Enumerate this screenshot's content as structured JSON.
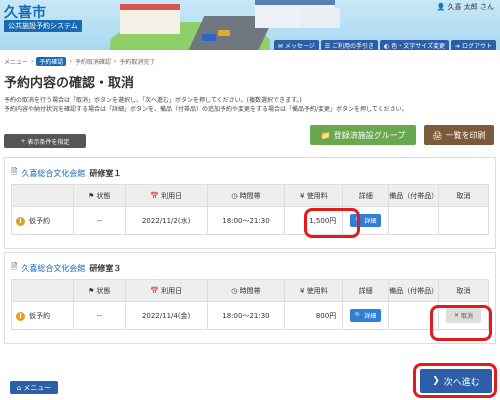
{
  "header": {
    "city_name": "久喜市",
    "system_name": "公共施設予約システム",
    "user_name": "久喜 太郎 さん",
    "buttons": [
      {
        "label": "メッセージ"
      },
      {
        "label": "ご利用の手引き"
      },
      {
        "label": "色・文字サイズ変更"
      },
      {
        "label": "ログアウト"
      }
    ]
  },
  "breadcrumb": [
    "メニュー",
    "予約確認",
    "予約取消確認",
    "予約取消完了"
  ],
  "page_title": "予約内容の確認・取消",
  "description": [
    "予約の取消を行う場合は「取消」ボタンを選択し、「次へ進む」ボタンを押してください。(複数選択できます。)",
    "予約内容や納付状況を確認する場合は「詳細」ボタンを、備品（付帯品）の追加予約や変更をする場合は「備品予約/変更」ボタンを押してください。"
  ],
  "actions": {
    "registered_group": "登録済施設グループ",
    "print_list": "一覧を印刷",
    "show_filters": "表示条件を指定"
  },
  "table_headers": {
    "status": "状態",
    "date": "利用日",
    "time": "時間帯",
    "fee": "使用料",
    "detail": "詳細",
    "equipment": "備品（付帯品）",
    "cancel": "取消"
  },
  "reservations": [
    {
      "facility": "久喜総合文化会館",
      "room": "研修室１",
      "status": "仮予約",
      "dash": "--",
      "date": "2022/11/2(水)",
      "time": "18:00～21:30",
      "fee": "1,500円",
      "detail_label": "詳細",
      "cancel_label": ""
    },
    {
      "facility": "久喜総合文化会館",
      "room": "研修室３",
      "status": "仮予約",
      "dash": "--",
      "date": "2022/11/4(金)",
      "time": "18:00～21:30",
      "fee": "800円",
      "detail_label": "詳細",
      "cancel_label": "取消"
    }
  ],
  "footer": {
    "menu": "メニュー",
    "next": "次へ進む"
  },
  "colors": {
    "primary": "#2c5fa8",
    "green": "#6aa84f",
    "brown": "#7d5a3a",
    "warning": "#e0a020",
    "highlight": "#e21c1c"
  }
}
